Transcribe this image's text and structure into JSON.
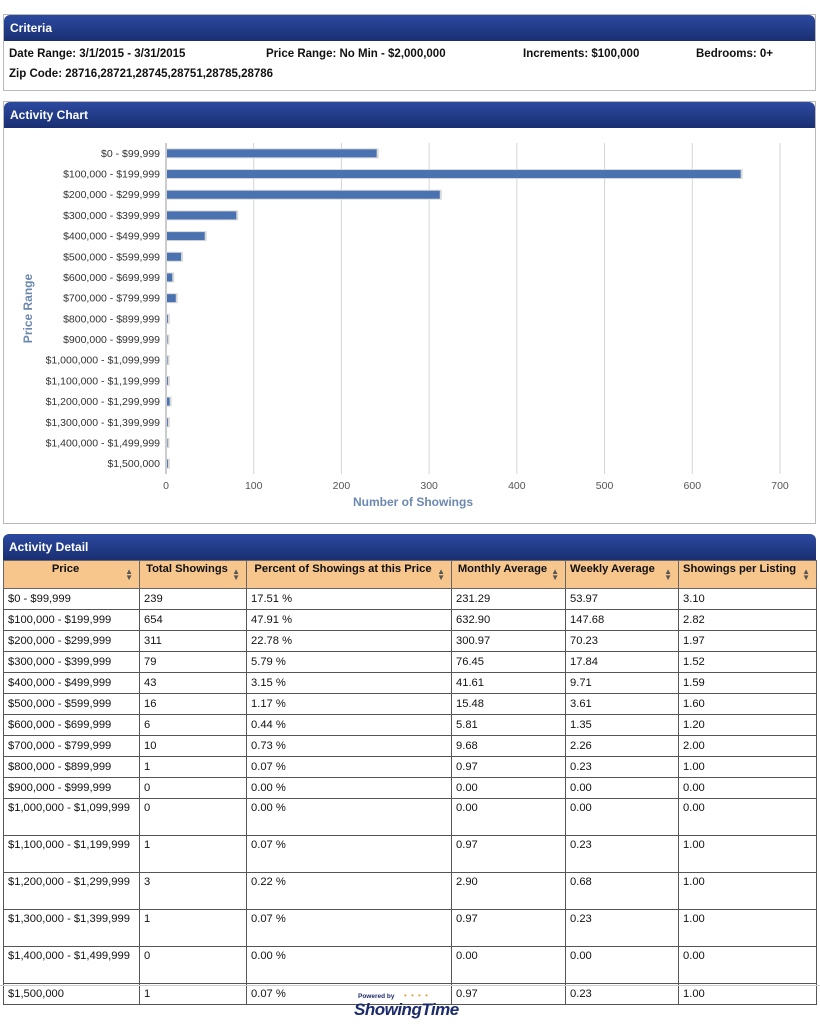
{
  "criteria": {
    "title": "Criteria",
    "date_range": "Date Range: 3/1/2015 - 3/31/2015",
    "price_range": "Price Range: No Min - $2,000,000",
    "increments": "Increments: $100,000",
    "bedrooms": "Bedrooms: 0+",
    "zip_code": "Zip Code:  28716,28721,28745,28751,28785,28786"
  },
  "activity_chart": {
    "title": "Activity Chart"
  },
  "chart_data": {
    "type": "bar",
    "orientation": "horizontal",
    "categories": [
      "$0 - $99,999",
      "$100,000 - $199,999",
      "$200,000 - $299,999",
      "$300,000 - $399,999",
      "$400,000 - $499,999",
      "$500,000 - $599,999",
      "$600,000 - $699,999",
      "$700,000 - $799,999",
      "$800,000 - $899,999",
      "$900,000 - $999,999",
      "$1,000,000 - $1,099,999",
      "$1,100,000 - $1,199,999",
      "$1,200,000 - $1,299,999",
      "$1,300,000 - $1,399,999",
      "$1,400,000 - $1,499,999",
      "$1,500,000"
    ],
    "values": [
      239,
      654,
      311,
      79,
      43,
      16,
      6,
      10,
      1,
      0,
      0,
      1,
      3,
      1,
      0,
      1
    ],
    "xlabel": "Number of Showings",
    "ylabel": "Price Range",
    "xlim": [
      0,
      700
    ],
    "xticks": [
      0,
      100,
      200,
      300,
      400,
      500,
      600,
      700
    ],
    "grid": true,
    "bar_color": "#4a72b0"
  },
  "activity_detail": {
    "title": "Activity Detail",
    "headers": [
      "Price",
      "Total Showings",
      "Percent of Showings at this Price",
      "Monthly Average",
      "Weekly Average",
      "Showings per Listing"
    ],
    "rows": [
      [
        "$0 - $99,999",
        "239",
        "17.51 %",
        "231.29",
        "53.97",
        "3.10"
      ],
      [
        "$100,000 - $199,999",
        "654",
        "47.91 %",
        "632.90",
        "147.68",
        "2.82"
      ],
      [
        "$200,000 - $299,999",
        "311",
        "22.78 %",
        "300.97",
        "70.23",
        "1.97"
      ],
      [
        "$300,000 - $399,999",
        "79",
        "5.79 %",
        "76.45",
        "17.84",
        "1.52"
      ],
      [
        "$400,000 - $499,999",
        "43",
        "3.15 %",
        "41.61",
        "9.71",
        "1.59"
      ],
      [
        "$500,000 - $599,999",
        "16",
        "1.17 %",
        "15.48",
        "3.61",
        "1.60"
      ],
      [
        "$600,000 - $699,999",
        "6",
        "0.44 %",
        "5.81",
        "1.35",
        "1.20"
      ],
      [
        "$700,000 - $799,999",
        "10",
        "0.73 %",
        "9.68",
        "2.26",
        "2.00"
      ],
      [
        "$800,000 - $899,999",
        "1",
        "0.07 %",
        "0.97",
        "0.23",
        "1.00"
      ],
      [
        "$900,000 - $999,999",
        "0",
        "0.00 %",
        "0.00",
        "0.00",
        "0.00"
      ],
      [
        "$1,000,000 - $1,099,999",
        "0",
        "0.00 %",
        "0.00",
        "0.00",
        "0.00"
      ],
      [
        "$1,100,000 - $1,199,999",
        "1",
        "0.07 %",
        "0.97",
        "0.23",
        "1.00"
      ],
      [
        "$1,200,000 - $1,299,999",
        "3",
        "0.22 %",
        "2.90",
        "0.68",
        "1.00"
      ],
      [
        "$1,300,000 - $1,399,999",
        "1",
        "0.07 %",
        "0.97",
        "0.23",
        "1.00"
      ],
      [
        "$1,400,000 - $1,499,999",
        "0",
        "0.00 %",
        "0.00",
        "0.00",
        "0.00"
      ],
      [
        "$1,500,000",
        "1",
        "0.07 %",
        "0.97",
        "0.23",
        "1.00"
      ]
    ]
  },
  "footer": {
    "powered_by": "Powered by",
    "brand": "ShowingTime"
  }
}
